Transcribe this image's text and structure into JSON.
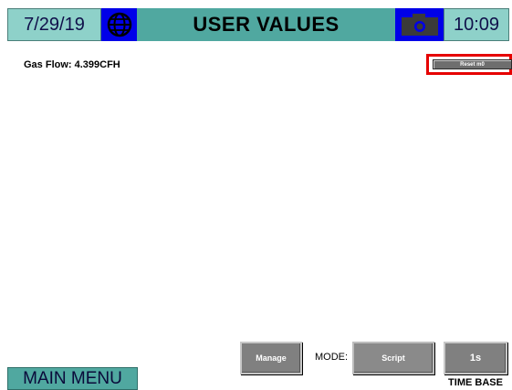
{
  "header": {
    "date": "7/29/19",
    "title": "USER VALUES",
    "time": "10:09",
    "globe_icon": "globe-icon",
    "camera_icon": "camera-icon"
  },
  "readout": {
    "gas_flow": "Gas Flow: 4.399CFH"
  },
  "buttons": {
    "reset": "Reset m0",
    "manage": "Manage",
    "mode_label": "MODE:",
    "mode_value": "Script",
    "time_base_value": "1s",
    "time_base_label": "TIME BASE",
    "main_menu": "MAIN MENU"
  },
  "colors": {
    "header_teal": "#50a8a0",
    "header_light_teal": "#8ed1c9",
    "icon_blue": "#0000e8",
    "highlight_red": "#e60000",
    "button_gray": "#808080"
  }
}
